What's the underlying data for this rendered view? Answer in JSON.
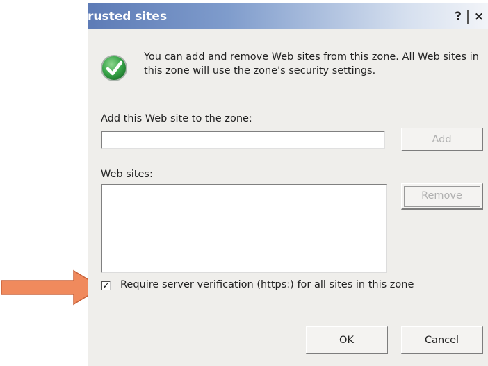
{
  "window": {
    "title": "rusted sites",
    "help_glyph": "?",
    "close_glyph": "×"
  },
  "intro": {
    "icon": "check-circle-icon",
    "text": "You can add and remove Web sites from this zone. All Web sites in this zone will use the zone's security settings."
  },
  "add_site": {
    "label": "Add this Web site to the zone:",
    "value": "",
    "button_label": "Add",
    "button_disabled": true
  },
  "websites": {
    "label": "Web sites:",
    "items": [],
    "remove_label": "Remove",
    "remove_disabled": true
  },
  "require_verification": {
    "checked": true,
    "check_glyph": "✓",
    "label": "Require server verification (https:) for all sites in this zone"
  },
  "buttons": {
    "ok": "OK",
    "cancel": "Cancel"
  },
  "annotation": {
    "icon": "orange-arrow-icon",
    "color": "#f08a5d"
  },
  "colors": {
    "icon_green": "#3aa64a",
    "dialog_bg": "#efeeeb",
    "title_gradient_start": "#5d7bb6"
  }
}
